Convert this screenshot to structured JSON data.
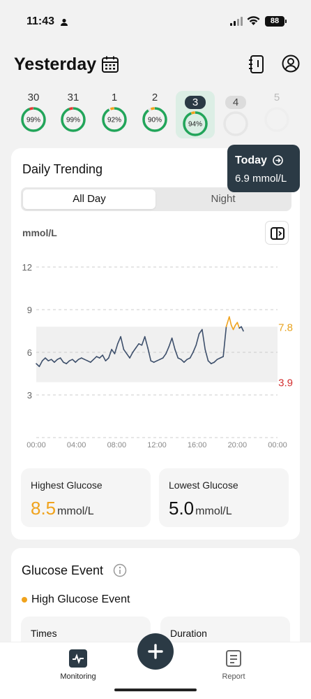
{
  "status": {
    "time": "11:43",
    "battery": "88"
  },
  "header": {
    "title": "Yesterday"
  },
  "days": [
    {
      "label": "30",
      "percent_label": "99%",
      "percent": 99,
      "color": "#22a55a",
      "marker": "#e53935",
      "state": "past"
    },
    {
      "label": "31",
      "percent_label": "99%",
      "percent": 99,
      "color": "#22a55a",
      "marker": "#e53935",
      "state": "past"
    },
    {
      "label": "1",
      "percent_label": "92%",
      "percent": 92,
      "color": "#22a55a",
      "marker": "#f0a31d",
      "state": "past"
    },
    {
      "label": "2",
      "percent_label": "90%",
      "percent": 90,
      "color": "#22a55a",
      "marker": "#f0a31d",
      "state": "past"
    },
    {
      "label": "3",
      "percent_label": "94%",
      "percent": 94,
      "color": "#22a55a",
      "marker": "#f0a31d",
      "state": "selected"
    },
    {
      "label": "4",
      "percent_label": "",
      "percent": 0,
      "color": "#e6e6e6",
      "marker": "",
      "state": "future"
    },
    {
      "label": "5",
      "percent_label": "",
      "percent": 0,
      "color": "#eeeeee",
      "marker": "",
      "state": "far"
    }
  ],
  "trending": {
    "title": "Daily Trending",
    "tooltip_title": "Today",
    "tooltip_value": "6.9 mmol/L",
    "tabs": [
      "All Day",
      "Night"
    ],
    "active_tab": "All Day",
    "unit": "mmol/L"
  },
  "chart_data": {
    "type": "line",
    "ylabel": "mmol/L",
    "ylim": [
      0,
      12
    ],
    "yticks": [
      "12",
      "9",
      "6",
      "3"
    ],
    "ytick_values": [
      12,
      9,
      6,
      3
    ],
    "xticks": [
      "00:00",
      "04:00",
      "08:00",
      "12:00",
      "16:00",
      "20:00",
      "00:00"
    ],
    "x_unit": "hours",
    "xlim": [
      0,
      24
    ],
    "target_range": {
      "low": 3.9,
      "high": 7.8,
      "low_label": "3.9",
      "high_label": "7.8",
      "low_color": "#d32f2f",
      "high_color": "#e8a320"
    },
    "series": [
      {
        "line_color": "#3d4f6b",
        "high_color": "#f0a31d",
        "points": [
          [
            0,
            5.2
          ],
          [
            0.3,
            5.0
          ],
          [
            0.6,
            5.4
          ],
          [
            0.9,
            5.6
          ],
          [
            1.2,
            5.4
          ],
          [
            1.5,
            5.5
          ],
          [
            1.8,
            5.3
          ],
          [
            2.1,
            5.5
          ],
          [
            2.4,
            5.6
          ],
          [
            2.7,
            5.3
          ],
          [
            3.0,
            5.2
          ],
          [
            3.3,
            5.4
          ],
          [
            3.6,
            5.5
          ],
          [
            3.9,
            5.3
          ],
          [
            4.2,
            5.5
          ],
          [
            4.5,
            5.6
          ],
          [
            4.8,
            5.5
          ],
          [
            5.1,
            5.4
          ],
          [
            5.4,
            5.3
          ],
          [
            5.7,
            5.5
          ],
          [
            6.0,
            5.7
          ],
          [
            6.3,
            5.6
          ],
          [
            6.6,
            5.8
          ],
          [
            6.9,
            5.4
          ],
          [
            7.2,
            5.6
          ],
          [
            7.5,
            6.2
          ],
          [
            7.8,
            5.9
          ],
          [
            8.1,
            6.6
          ],
          [
            8.4,
            7.1
          ],
          [
            8.7,
            6.2
          ],
          [
            9.0,
            5.9
          ],
          [
            9.3,
            5.6
          ],
          [
            9.6,
            6.0
          ],
          [
            9.9,
            6.3
          ],
          [
            10.2,
            6.6
          ],
          [
            10.5,
            6.5
          ],
          [
            10.8,
            7.1
          ],
          [
            11.1,
            6.3
          ],
          [
            11.4,
            5.4
          ],
          [
            11.7,
            5.3
          ],
          [
            12.0,
            5.4
          ],
          [
            12.3,
            5.5
          ],
          [
            12.6,
            5.6
          ],
          [
            12.9,
            5.9
          ],
          [
            13.2,
            6.4
          ],
          [
            13.5,
            7.0
          ],
          [
            13.8,
            6.2
          ],
          [
            14.1,
            5.6
          ],
          [
            14.4,
            5.5
          ],
          [
            14.7,
            5.3
          ],
          [
            15.0,
            5.5
          ],
          [
            15.3,
            5.6
          ],
          [
            15.6,
            6.0
          ],
          [
            15.9,
            6.5
          ],
          [
            16.2,
            7.3
          ],
          [
            16.5,
            7.6
          ],
          [
            16.8,
            6.2
          ],
          [
            17.1,
            5.4
          ],
          [
            17.4,
            5.2
          ],
          [
            17.7,
            5.3
          ],
          [
            18.0,
            5.5
          ],
          [
            18.3,
            5.6
          ],
          [
            18.6,
            5.7
          ],
          [
            18.9,
            7.8
          ],
          [
            19.2,
            8.5
          ],
          [
            19.4,
            7.9
          ],
          [
            19.6,
            7.6
          ],
          [
            19.8,
            7.9
          ],
          [
            20.0,
            8.1
          ],
          [
            20.2,
            7.7
          ],
          [
            20.4,
            7.8
          ],
          [
            20.6,
            7.5
          ]
        ]
      }
    ]
  },
  "stats": {
    "highest_label": "Highest Glucose",
    "highest_value": "8.5",
    "highest_unit": "mmol/L",
    "highest_color": "#f0a31d",
    "lowest_label": "Lowest Glucose",
    "lowest_value": "5.0",
    "lowest_unit": "mmol/L"
  },
  "events": {
    "title": "Glucose Event",
    "high_event": "High Glucose Event",
    "times_label": "Times",
    "duration_label": "Duration"
  },
  "tabbar": {
    "monitoring": "Monitoring",
    "report": "Report"
  }
}
